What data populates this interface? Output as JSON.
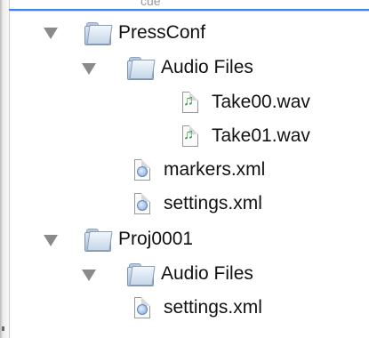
{
  "tree": {
    "cut_top_text": "cue",
    "items": [
      {
        "label": "PressConf",
        "type": "folder",
        "level": 0,
        "expanded": true
      },
      {
        "label": "Audio Files",
        "type": "folder",
        "level": 1,
        "expanded": true
      },
      {
        "label": "Take00.wav",
        "type": "audio",
        "level": 2
      },
      {
        "label": "Take01.wav",
        "type": "audio",
        "level": 2
      },
      {
        "label": "markers.xml",
        "type": "xml",
        "level": 1
      },
      {
        "label": "settings.xml",
        "type": "xml",
        "level": 1
      },
      {
        "label": "Proj0001",
        "type": "folder",
        "level": 0,
        "expanded": true
      },
      {
        "label": "Audio Files",
        "type": "folder",
        "level": 1,
        "expanded": true
      },
      {
        "label": "settings.xml",
        "type": "xml",
        "level": 1
      }
    ]
  },
  "colors": {
    "selection_blue": "#3a84f2",
    "disclosure_gray": "#8a8a8a",
    "audio_note_green": "#2f9a3a"
  },
  "icons": {
    "disclosure": "disclosure-triangle-open-icon",
    "folder": "folder-icon",
    "audio": "audio-file-icon",
    "xml": "xml-file-icon"
  }
}
